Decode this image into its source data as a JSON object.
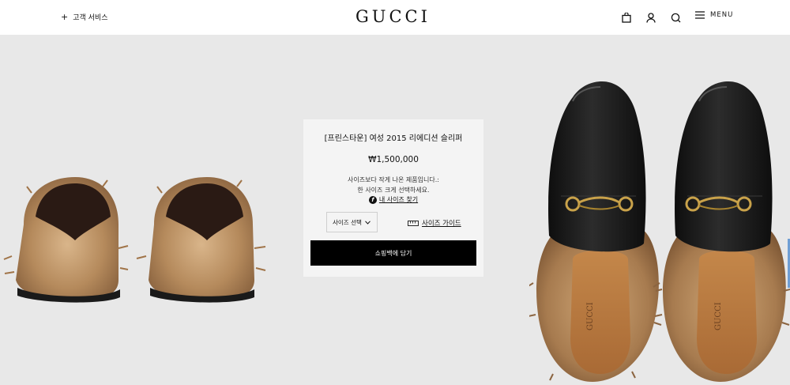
{
  "header": {
    "customer_service": "고객 서비스",
    "logo": "GUCCI",
    "menu_label": "MENU"
  },
  "product": {
    "title": "[프린스타운] 여성 2015 리에디션 슬리퍼",
    "price": "₩1,500,000",
    "note_line1": "사이즈보다 작게 나온 제품입니다.:",
    "note_line2": "한 사이즈 크게 선택하세요.",
    "fit_badge": "f",
    "fit_link": "내 사이즈 찾기",
    "size_select": "사이즈 선택",
    "size_guide": "사이즈 가이드",
    "add_to_bag": "쇼핑백에 담기"
  },
  "colors": {
    "header_bg": "#ffffff",
    "hero_bg": "#e8e8e8",
    "card_bg": "#f4f4f4",
    "button_bg": "#000000",
    "leather": "#141414",
    "fur": "#b58a5c",
    "hardware": "#c9a24a"
  }
}
